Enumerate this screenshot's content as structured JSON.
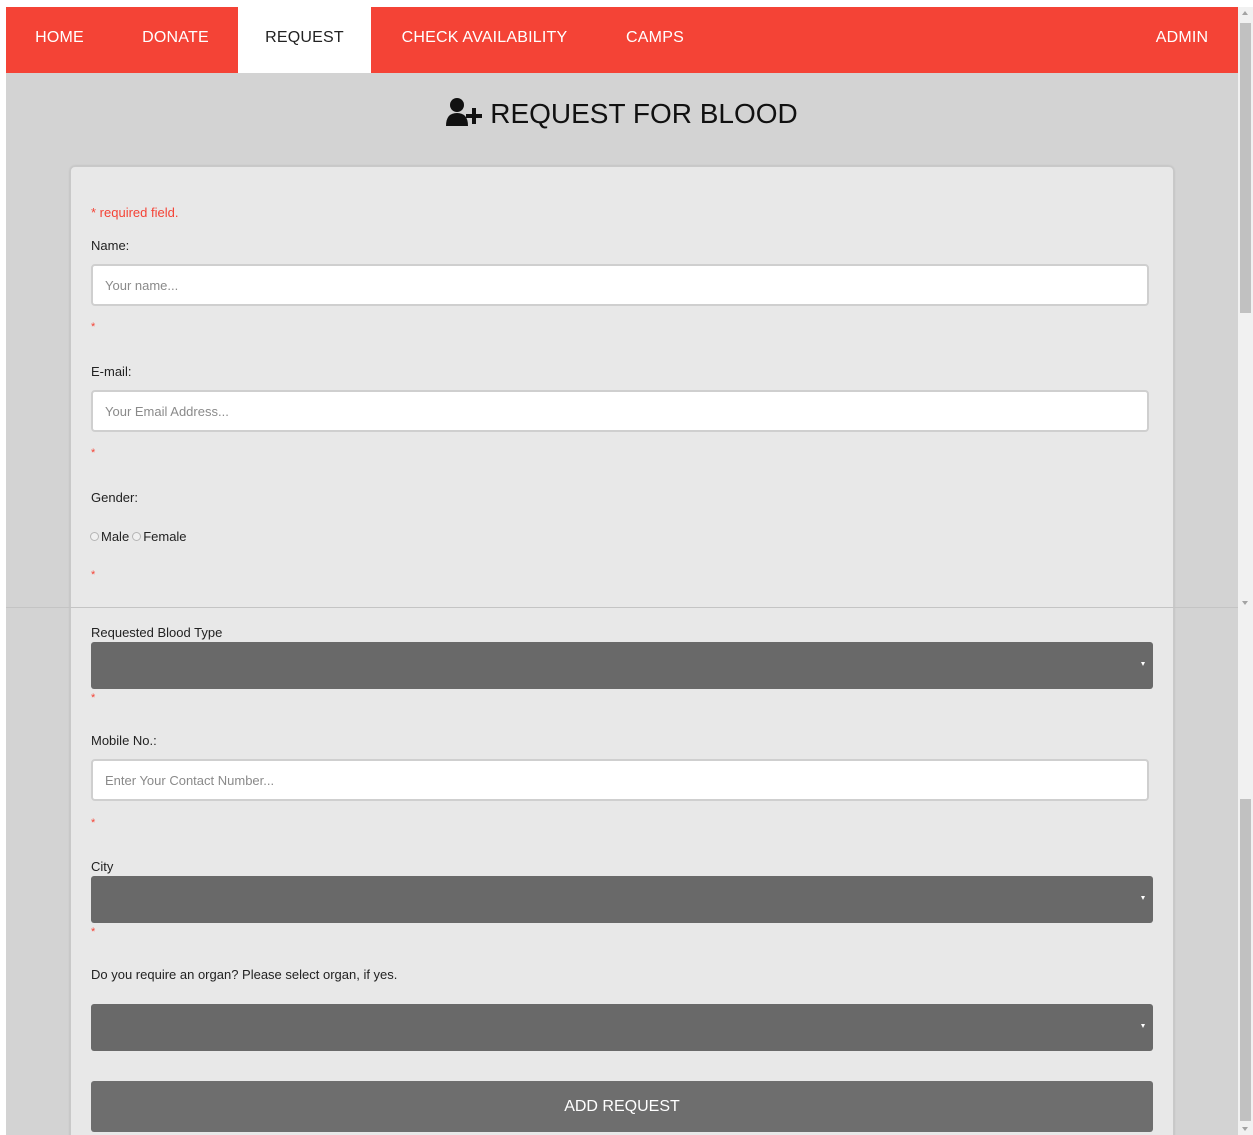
{
  "nav": {
    "home": "HOME",
    "donate": "DONATE",
    "request": "REQUEST",
    "check": "CHECK AVAILABILITY",
    "camps": "CAMPS",
    "admin": "ADMIN"
  },
  "page": {
    "title": "REQUEST FOR BLOOD",
    "icon": "user-plus-icon"
  },
  "form": {
    "required_note": "* required field.",
    "name_label": "Name:",
    "name_placeholder": "Your name...",
    "email_label": "E-mail:",
    "email_placeholder": "Your Email Address...",
    "gender_label": "Gender:",
    "gender_options": [
      "Male",
      "Female"
    ],
    "blood_type_label": "Requested Blood Type",
    "blood_type_value": "",
    "mobile_label": "Mobile No.:",
    "mobile_placeholder": "Enter Your Contact Number...",
    "city_label": "City",
    "city_value": "",
    "organ_label": "Do you require an organ? Please select organ, if yes.",
    "organ_value": "",
    "required_star": "*",
    "submit_label": "ADD REQUEST"
  },
  "colors": {
    "accent": "#f44336",
    "select_bg": "#696969",
    "button_bg": "#6e6e6e"
  }
}
